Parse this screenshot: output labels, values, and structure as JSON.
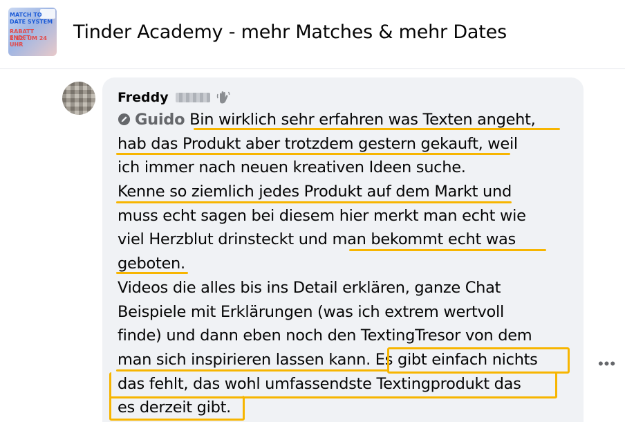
{
  "header": {
    "group_title": "Tinder Academy - mehr Matches & mehr Dates",
    "thumb_lines": [
      "MATCH TO",
      "DATE SYSTEM",
      "RABATT ENDET",
      "2.12. UM 24 UHR"
    ]
  },
  "comment": {
    "author": "Freddy",
    "mention": "Guido",
    "lines": [
      " Bin wirklich sehr erfahren was Texten angeht,",
      "hab das Produkt aber trotzdem gestern gekauft, weil",
      "ich immer nach neuen kreativen Ideen suche.",
      "Kenne so ziemlich jedes Produkt auf dem Markt und",
      "muss echt sagen bei diesem hier merkt man echt wie",
      "viel Herzblut drinsteckt und man bekommt echt was",
      "geboten.",
      "Videos die alles bis ins Detail erklären, ganze Chat",
      "Beispiele mit Erklärungen (was ich extrem wertvoll",
      "finde) und dann eben noch den TextingTresor von dem",
      "man sich inspirieren lassen kann. Es gibt einfach nichts",
      "das fehlt, das wohl umfassendste Textingprodukt das",
      "es derzeit gibt."
    ]
  },
  "more_label": "•••",
  "colors": {
    "highlight": "#f7b500",
    "bubble": "#f0f2f5",
    "mention": "#65676b"
  }
}
